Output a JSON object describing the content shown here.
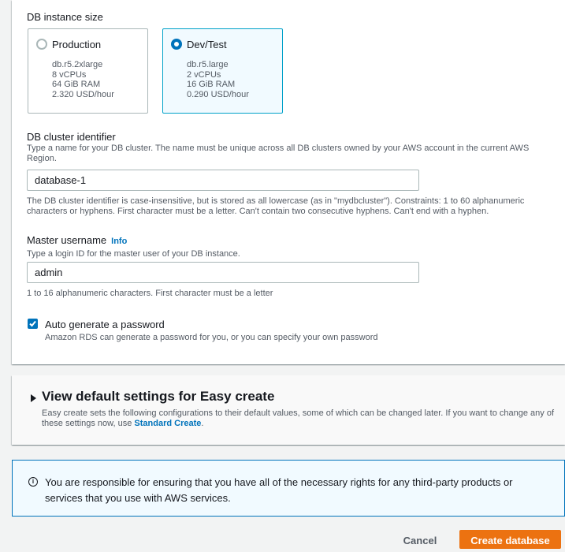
{
  "instance_size": {
    "label": "DB instance size",
    "options": [
      {
        "title": "Production",
        "specs": [
          "db.r5.2xlarge",
          "8 vCPUs",
          "64 GiB RAM",
          "2.320 USD/hour"
        ],
        "selected": false
      },
      {
        "title": "Dev/Test",
        "specs": [
          "db.r5.large",
          "2 vCPUs",
          "16 GiB RAM",
          "0.290 USD/hour"
        ],
        "selected": true
      }
    ]
  },
  "cluster_identifier": {
    "label": "DB cluster identifier",
    "description": "Type a name for your DB cluster. The name must be unique across all DB clusters owned by your AWS account in the current AWS Region.",
    "value": "database-1",
    "constraint": "The DB cluster identifier is case-insensitive, but is stored as all lowercase (as in \"mydbcluster\"). Constraints: 1 to 60 alphanumeric characters or hyphens. First character must be a letter. Can't contain two consecutive hyphens. Can't end with a hyphen."
  },
  "master_username": {
    "label": "Master username",
    "info_link": "Info",
    "description": "Type a login ID for the master user of your DB instance.",
    "value": "admin",
    "constraint": "1 to 16 alphanumeric characters. First character must be a letter"
  },
  "auto_password": {
    "label": "Auto generate a password",
    "description": "Amazon RDS can generate a password for you, or you can specify your own password",
    "checked": true
  },
  "default_settings": {
    "title": "View default settings for Easy create",
    "description": "Easy create sets the following configurations to their default values, some of which can be changed later. If you want to change any of these settings now, use",
    "link": "Standard Create",
    "suffix": "."
  },
  "notice": {
    "icon": "info-icon",
    "text": "You are responsible for ensuring that you have all of the necessary rights for any third-party products or services that you use with AWS services."
  },
  "actions": {
    "cancel": "Cancel",
    "create": "Create database"
  },
  "colors": {
    "primary": "#ec7211",
    "link": "#0073bb",
    "selected_border": "#00a1c9"
  }
}
